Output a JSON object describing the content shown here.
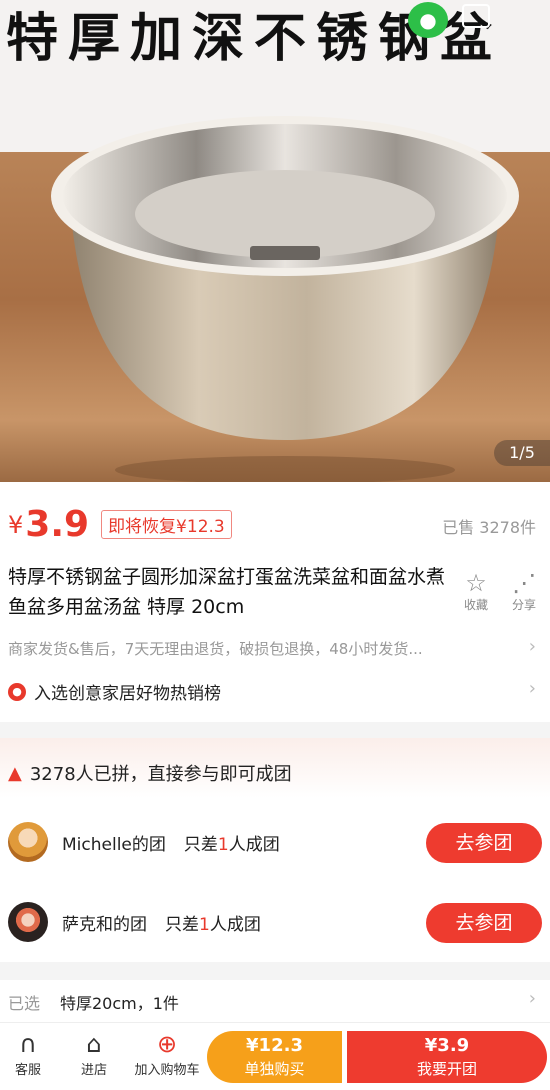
{
  "hero": {
    "overlay_text": "特厚加深不锈钢盆",
    "pager": "1/5"
  },
  "product": {
    "currency": "¥",
    "price": "3.9",
    "restore_tag": "即将恢复¥12.3",
    "sold": "已售 3278件",
    "title": "特厚不锈钢盆子圆形加深盆打蛋盆洗菜盆和面盆水煮鱼盆多用盆汤盆 特厚 20cm",
    "collect_label": "收藏",
    "share_label": "分享",
    "service": "商家发货&售后，7天无理由退货，破损包退换，48小时发货...",
    "rank": "入选创意家居好物热销榜"
  },
  "group": {
    "header": "3278人已拼，直接参与即可成团",
    "rows": [
      {
        "name": "Michelle的团",
        "need_prefix": "只差",
        "need_num": "1",
        "need_suffix": "人成团",
        "button": "去参团"
      },
      {
        "name": "萨克和的团",
        "need_prefix": "只差",
        "need_num": "1",
        "need_suffix": "人成团",
        "button": "去参团"
      }
    ]
  },
  "selection": {
    "label": "已选",
    "value": "特厚20cm，1件"
  },
  "bottom_bar": {
    "service_label": "客服",
    "store_label": "进店",
    "cart_label": "加入购物车",
    "solo_price": "¥12.3",
    "solo_label": "单独购买",
    "group_price": "¥3.9",
    "group_label": "我要开团"
  },
  "colors": {
    "accent": "#ee3b2f",
    "orange": "#f6a01a",
    "wechat_green": "#2dbf48"
  },
  "icons": [
    "wechat-icon",
    "message-icon",
    "star-icon",
    "share-icon",
    "chevron-right-icon",
    "rank-icon",
    "fire-icon",
    "headset-icon",
    "store-icon",
    "cart-icon"
  ]
}
